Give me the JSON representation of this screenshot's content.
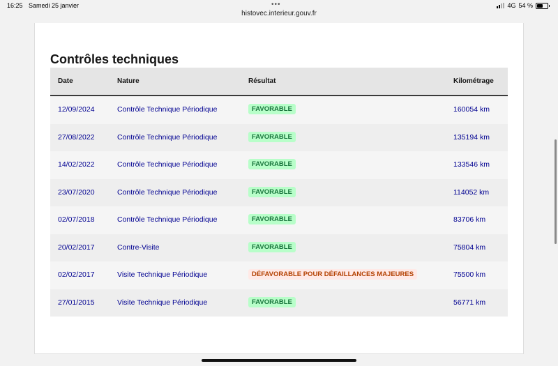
{
  "status_bar": {
    "time": "16:25",
    "date": "Samedi 25 janvier",
    "network": "4G",
    "battery": "54 %"
  },
  "browser": {
    "url": "histovec.interieur.gouv.fr"
  },
  "section": {
    "title": "Contrôles techniques"
  },
  "table": {
    "headers": {
      "date": "Date",
      "nature": "Nature",
      "result": "Résultat",
      "km": "Kilométrage"
    },
    "rows": [
      {
        "date": "12/09/2024",
        "nature": "Contrôle Technique Périodique",
        "result": "FAVORABLE",
        "status": "favorable",
        "km": "160054 km"
      },
      {
        "date": "27/08/2022",
        "nature": "Contrôle Technique Périodique",
        "result": "FAVORABLE",
        "status": "favorable",
        "km": "135194 km"
      },
      {
        "date": "14/02/2022",
        "nature": "Contrôle Technique Périodique",
        "result": "FAVORABLE",
        "status": "favorable",
        "km": "133546 km"
      },
      {
        "date": "23/07/2020",
        "nature": "Contrôle Technique Périodique",
        "result": "FAVORABLE",
        "status": "favorable",
        "km": "114052 km"
      },
      {
        "date": "02/07/2018",
        "nature": "Contrôle Technique Périodique",
        "result": "FAVORABLE",
        "status": "favorable",
        "km": "83706 km"
      },
      {
        "date": "20/02/2017",
        "nature": "Contre-Visite",
        "result": "FAVORABLE",
        "status": "favorable",
        "km": "75804 km"
      },
      {
        "date": "02/02/2017",
        "nature": "Visite Technique Périodique",
        "result": "DÉFAVORABLE POUR DÉFAILLANCES MAJEURES",
        "status": "defavorable",
        "km": "75500 km"
      },
      {
        "date": "27/01/2015",
        "nature": "Visite Technique Périodique",
        "result": "FAVORABLE",
        "status": "favorable",
        "km": "56771 km"
      }
    ]
  },
  "colors": {
    "link": "#000091",
    "favorable_bg": "#b8fec9",
    "favorable_text": "#18753c",
    "defavorable_bg": "#ffe9e6",
    "defavorable_text": "#b34000"
  }
}
